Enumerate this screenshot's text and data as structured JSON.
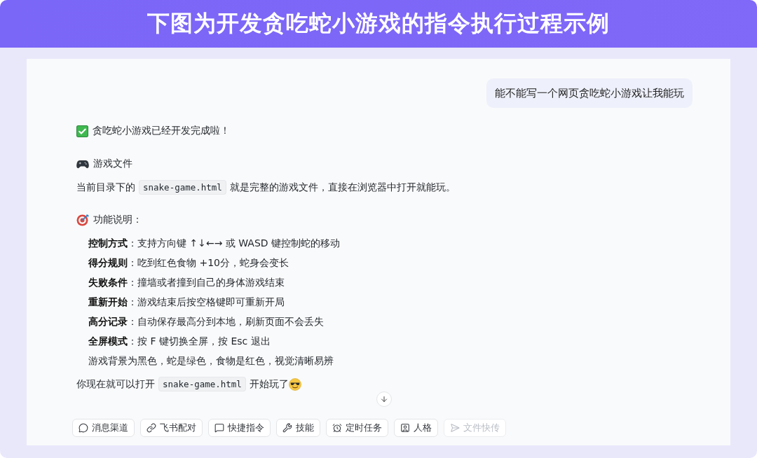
{
  "banner": {
    "title": "下图为开发贪吃蛇小游戏的指令执行过程示例"
  },
  "chat": {
    "user_message": "能不能写一个网页贪吃蛇小游戏让我能玩",
    "reply": {
      "status_line": "贪吃蛇小游戏已经开发完成啦！",
      "file_heading": "游戏文件",
      "file_paragraph": [
        {
          "kind": "text",
          "text": "当前目录下的"
        },
        {
          "kind": "code",
          "text": "snake-game.html"
        },
        {
          "kind": "text",
          "text": "就是完整的游戏文件，直接在浏览器中打开就能玩。"
        }
      ],
      "features_heading": "功能说明：",
      "features": [
        "**控制方式**：支持方向键 ↑↓←→ 或 WASD 键控制蛇的移动",
        "**得分规则**：吃到红色食物 +10分，蛇身会变长",
        "**失败条件**：撞墙或者撞到自己的身体游戏结束",
        "**重新开始**：游戏结束后按空格键即可重新开局",
        "**高分记录**：自动保存最高分到本地，刷新页面不会丢失",
        "**全屏模式**：按 F 键切换全屏，按 Esc 退出",
        "游戏背景为黑色，蛇是绿色，食物是红色，视觉清晰易辨"
      ],
      "closing": [
        {
          "kind": "text",
          "text": "你现在就可以打开"
        },
        {
          "kind": "code",
          "text": "snake-game.html"
        },
        {
          "kind": "text",
          "text": "开始玩了"
        }
      ]
    }
  },
  "toolbar": [
    {
      "label": "消息渠道",
      "disabled": false
    },
    {
      "label": "飞书配对",
      "disabled": false
    },
    {
      "label": "快捷指令",
      "disabled": false
    },
    {
      "label": "技能",
      "disabled": false
    },
    {
      "label": "定时任务",
      "disabled": false
    },
    {
      "label": "人格",
      "disabled": false
    },
    {
      "label": "文件快传",
      "disabled": true
    }
  ]
}
